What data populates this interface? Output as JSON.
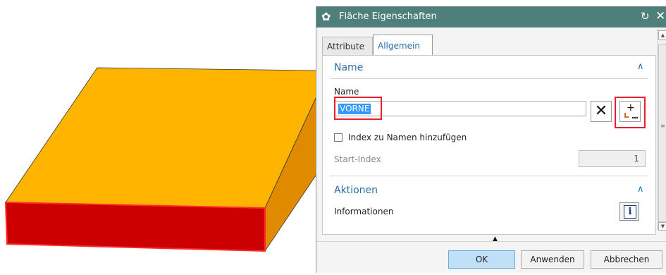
{
  "dialog": {
    "title": "Fläche Eigenschaften",
    "header_color": "#4f7f7a",
    "tabs": [
      {
        "label": "Attribute",
        "active": false
      },
      {
        "label": "Allgemein",
        "active": true
      }
    ]
  },
  "name_section": {
    "title": "Name",
    "field_label": "Name",
    "field_value": "VORNE",
    "index_checkbox_label": "Index zu Namen hinzufügen",
    "index_checked": false,
    "start_index_label": "Start-Index",
    "start_index_value": "1"
  },
  "actions_section": {
    "title": "Aktionen",
    "info_label": "Informationen"
  },
  "footer": {
    "ok_label": "OK",
    "apply_label": "Anwenden",
    "cancel_label": "Abbrechen"
  },
  "model": {
    "top_face_color": "#ffb400",
    "front_face_color": "#cc0000",
    "side_face_color": "#e08a00"
  },
  "icons": [
    "gear-icon",
    "reset-icon",
    "close-icon",
    "clear-icon",
    "add-name-icon",
    "info-icon",
    "collapse-icon"
  ]
}
